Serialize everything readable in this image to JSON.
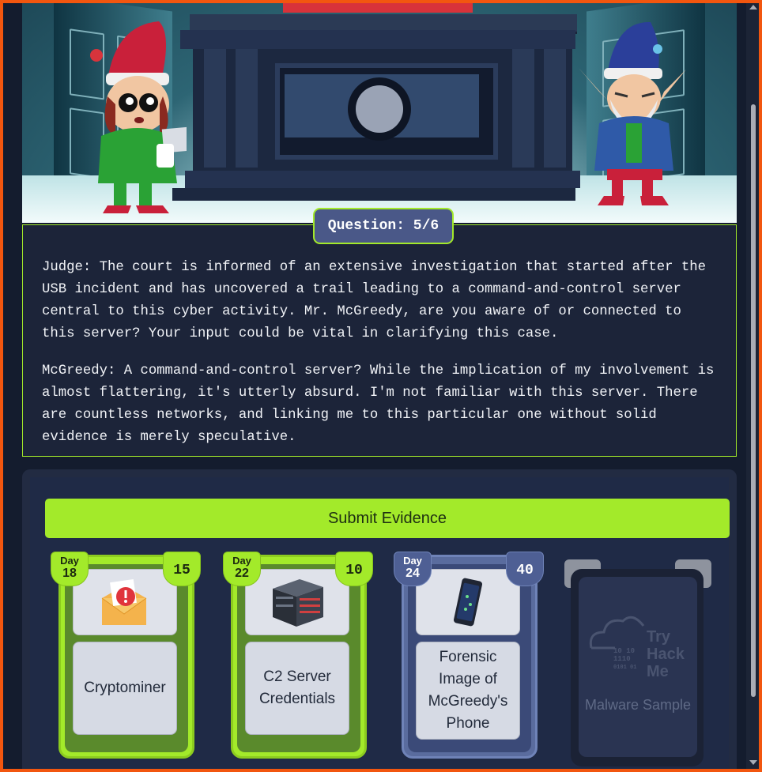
{
  "scene": {
    "question_badge": "Question: 5/6"
  },
  "dialogue": {
    "judge": "Judge: The court is informed of an extensive investigation that started after the USB incident and has uncovered a trail leading to a command-and-control server central to this cyber activity. Mr. McGreedy, are you aware of or connected to this server? Your input could be vital in clarifying this case.",
    "mcgreedy": "McGreedy: A command-and-control server? While the implication of my involvement is almost flattering, it's utterly absurd. I'm not familiar with this server. There are countless networks, and linking me to this particular one without solid evidence is merely speculative."
  },
  "evidence": {
    "submit_label": "Submit Evidence",
    "cards": [
      {
        "day_label": "Day",
        "day": "18",
        "points": "15",
        "title": "Cryptominer",
        "icon": "envelope-alert-icon",
        "state": "active"
      },
      {
        "day_label": "Day",
        "day": "22",
        "points": "10",
        "title": "C2 Server Credentials",
        "icon": "server-rack-icon",
        "state": "active"
      },
      {
        "day_label": "Day",
        "day": "24",
        "points": "40",
        "title": "Forensic Image of McGreedy's Phone",
        "icon": "smartphone-icon",
        "state": "selected"
      },
      {
        "title": "Malware Sample",
        "icon": "tryhackme-logo",
        "logo_text": [
          "Try",
          "Hack",
          "Me"
        ],
        "state": "locked"
      }
    ]
  },
  "colors": {
    "accent_green": "#a3ea2a",
    "frame_orange": "#f2560f",
    "badge_blue": "#4a5888"
  }
}
